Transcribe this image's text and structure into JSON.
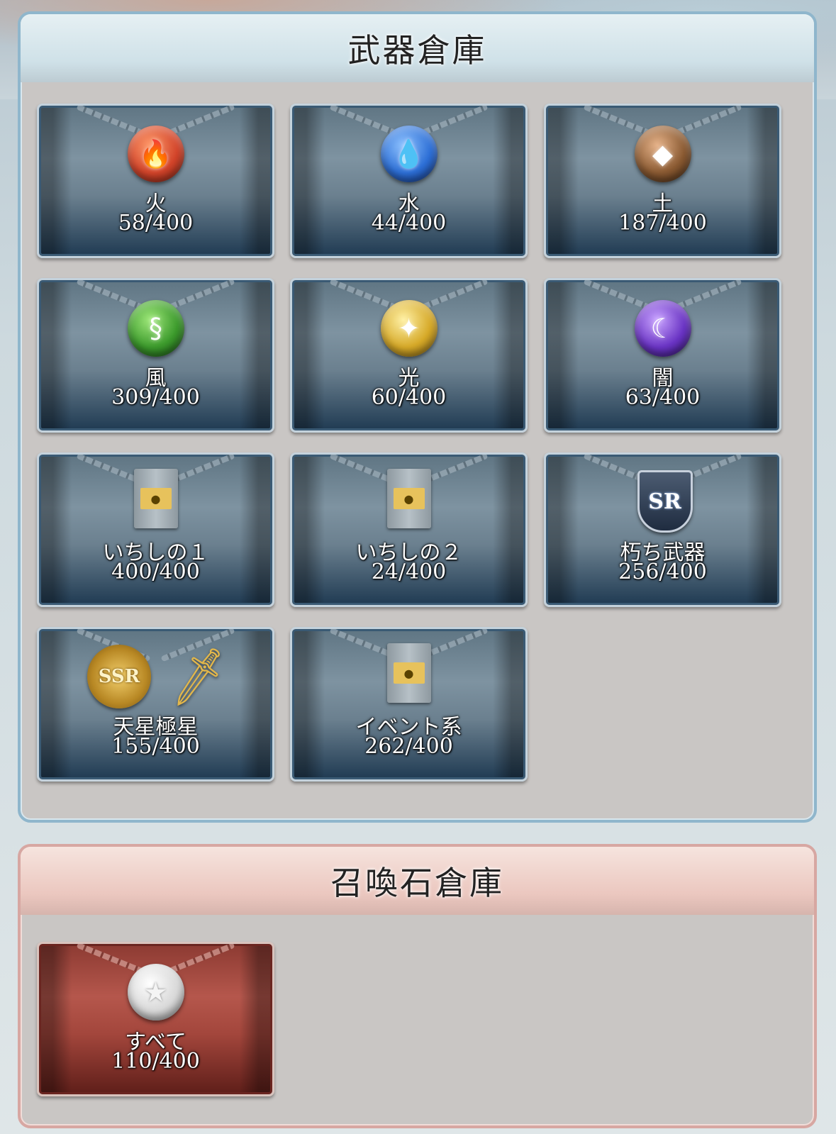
{
  "weapon_storage": {
    "title": "武器倉庫",
    "boxes": [
      {
        "name": "火",
        "count": "58/400",
        "icon": "fire-element-icon",
        "glyph": "🔥",
        "color": "#d2442a"
      },
      {
        "name": "水",
        "count": "44/400",
        "icon": "water-element-icon",
        "glyph": "💧",
        "color": "#2d6fd6"
      },
      {
        "name": "土",
        "count": "187/400",
        "icon": "earth-element-icon",
        "glyph": "◆",
        "color": "#8a5a32"
      },
      {
        "name": "風",
        "count": "309/400",
        "icon": "wind-element-icon",
        "glyph": "§",
        "color": "#3c9a2c"
      },
      {
        "name": "光",
        "count": "60/400",
        "icon": "light-element-icon",
        "glyph": "✦",
        "color": "#d6a928"
      },
      {
        "name": "闇",
        "count": "63/400",
        "icon": "dark-element-icon",
        "glyph": "☾",
        "color": "#6a34c4"
      },
      {
        "name": "いちしの１",
        "count": "400/400",
        "icon": "locked-storage-icon"
      },
      {
        "name": "いちしの２",
        "count": "24/400",
        "icon": "locked-storage-icon"
      },
      {
        "name": "朽ち武器",
        "count": "256/400",
        "icon": "sr-badge-icon",
        "badge_text": "SR"
      },
      {
        "name": "天星極星",
        "count": "155/400",
        "icon": "ssr-badge-icon",
        "badge_text": "SSR"
      },
      {
        "name": "イベント系",
        "count": "262/400",
        "icon": "locked-storage-icon"
      }
    ]
  },
  "summon_storage": {
    "title": "召喚石倉庫",
    "boxes": [
      {
        "name": "すべて",
        "count": "110/400",
        "icon": "star-icon",
        "glyph": "★",
        "color": "#d8d8d8"
      }
    ]
  }
}
